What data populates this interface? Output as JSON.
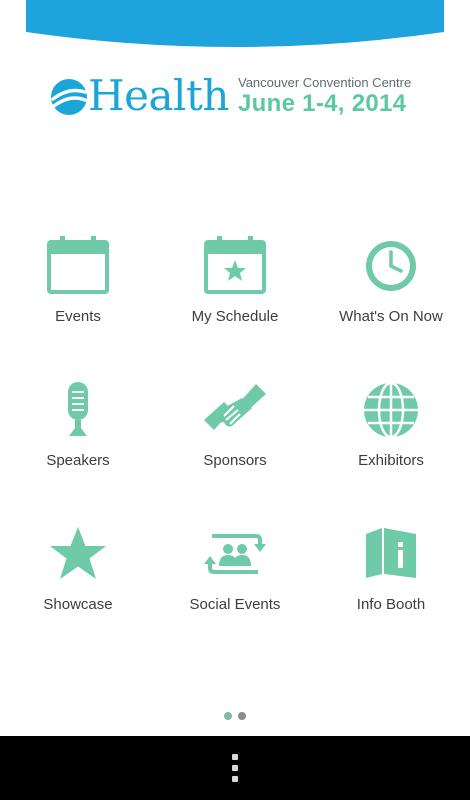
{
  "colors": {
    "banner": "#1ea3dc",
    "icon": "#6fcaa8",
    "brand": "#1aa7d8",
    "date": "#5cc8a0",
    "label": "#3d3d3d",
    "dot_active": "#7fb8a4",
    "dot_inactive": "#8a8a8a"
  },
  "header": {
    "brand": "Health",
    "venue": "Vancouver Convention Centre",
    "dates": "June 1-4, 2014"
  },
  "menu": [
    {
      "label": "Events",
      "icon": "calendar-icon"
    },
    {
      "label": "My Schedule",
      "icon": "calendar-star-icon"
    },
    {
      "label": "What's On Now",
      "icon": "clock-icon"
    },
    {
      "label": "Speakers",
      "icon": "microphone-icon"
    },
    {
      "label": "Sponsors",
      "icon": "handshake-icon"
    },
    {
      "label": "Exhibitors",
      "icon": "globe-icon"
    },
    {
      "label": "Showcase",
      "icon": "star-icon"
    },
    {
      "label": "Social Events",
      "icon": "people-icon"
    },
    {
      "label": "Info Booth",
      "icon": "info-booth-icon"
    }
  ],
  "pager": {
    "pages": 2,
    "active": 1
  },
  "navbar": {
    "menu_icon": "overflow-menu-icon"
  }
}
